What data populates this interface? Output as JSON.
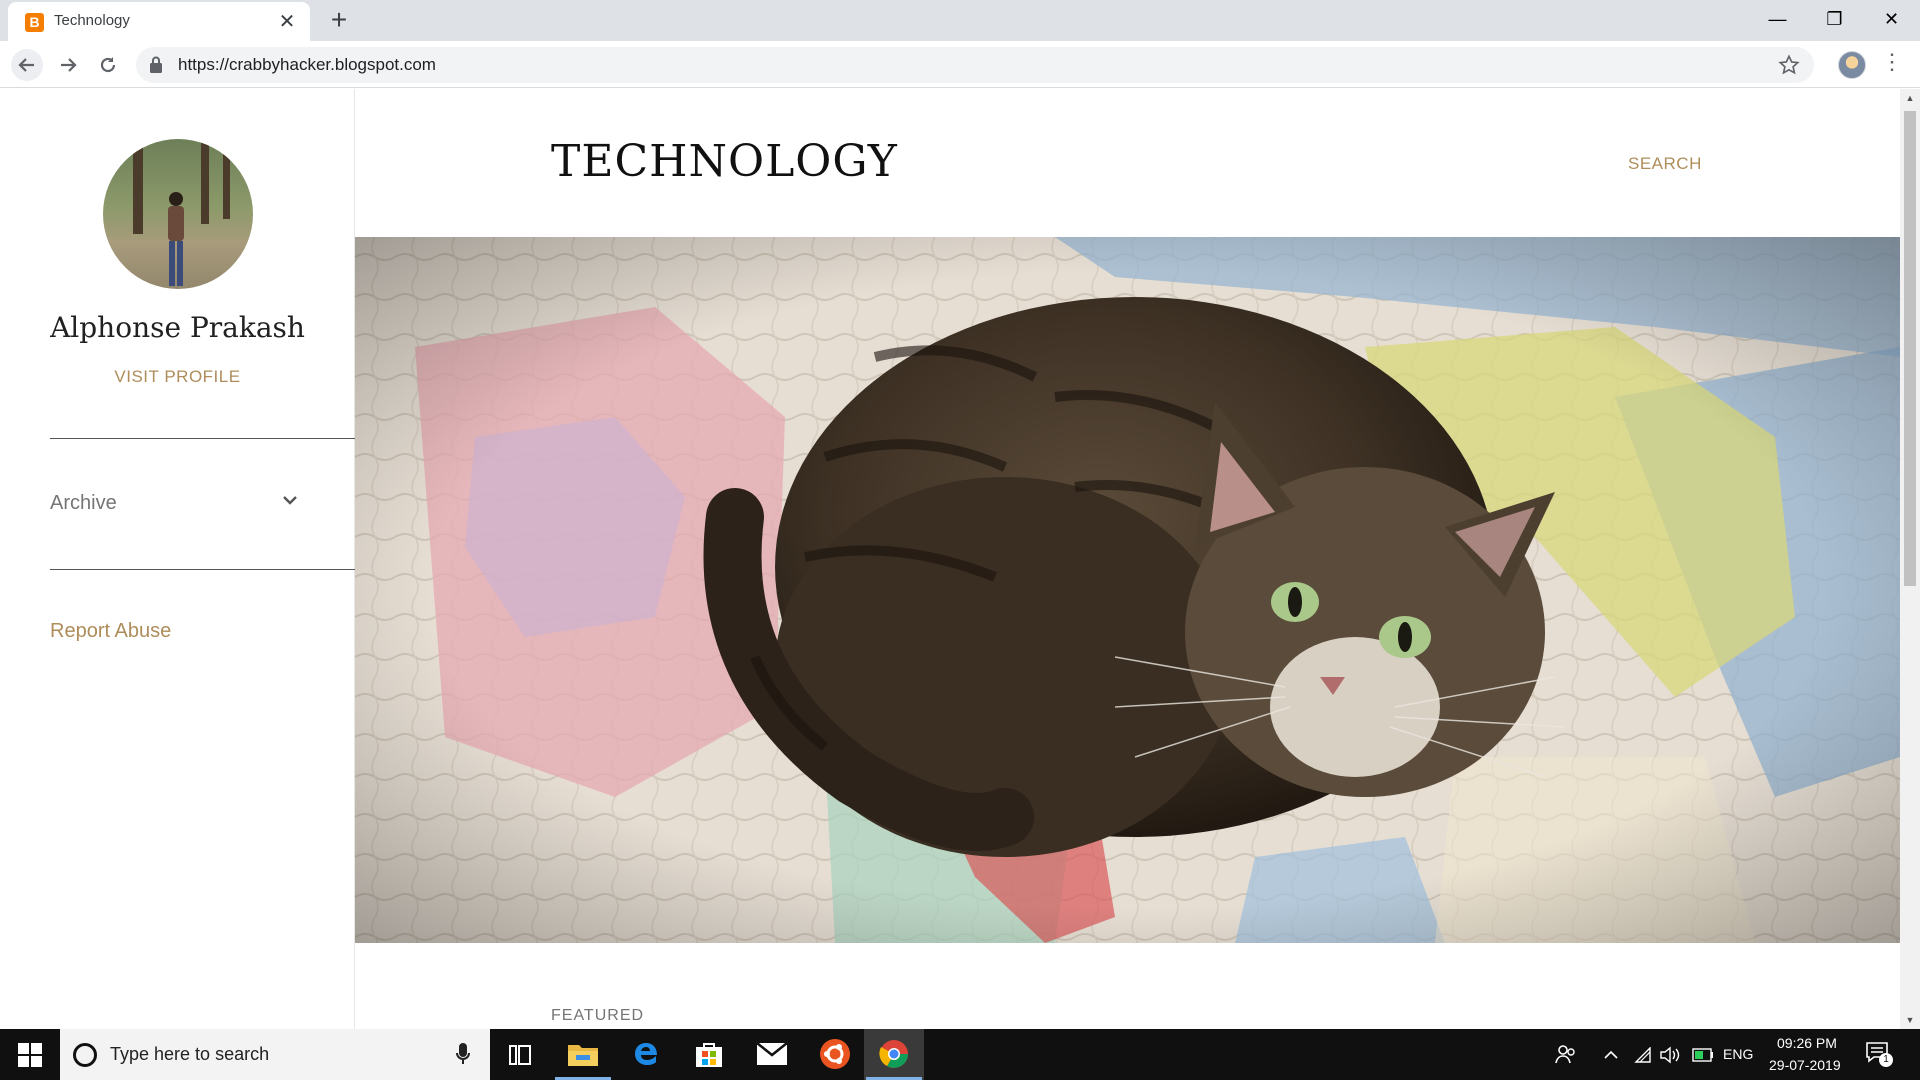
{
  "browser": {
    "tab_title": "Technology",
    "tab_favicon": "B",
    "new_tab_label": "+",
    "close_tab_label": "✕",
    "window_controls": {
      "minimize": "—",
      "maximize": "❐",
      "close": "✕"
    },
    "url": "https://crabbyhacker.blogspot.com",
    "menu_label": "⋮"
  },
  "sidebar": {
    "profile_name": "Alphonse Prakash",
    "visit_profile": "VISIT PROFILE",
    "archive_label": "Archive",
    "report_abuse": "Report Abuse"
  },
  "blog": {
    "title": "TECHNOLOGY",
    "search_label": "SEARCH",
    "featured_label": "FEATURED"
  },
  "taskbar": {
    "search_placeholder": "Type here to search",
    "language": "ENG",
    "time": "09:26 PM",
    "date": "29-07-2019",
    "notification_count": "1"
  },
  "colors": {
    "accent": "#ae8d5a",
    "tabstrip_bg": "#dee1e6",
    "taskbar_bg": "#101010"
  },
  "icons": {
    "back": "arrow-left-icon",
    "forward": "arrow-right-icon",
    "reload": "reload-icon",
    "lock": "lock-icon",
    "bookmark": "star-icon",
    "menu": "kebab-menu-icon",
    "archive_toggle": "chevron-down-icon",
    "start": "windows-logo-icon",
    "task_view": "task-view-icon",
    "file_explorer": "folder-icon",
    "edge": "edge-icon",
    "store": "store-icon",
    "mail": "mail-icon",
    "ubuntu": "ubuntu-icon",
    "chrome": "chrome-icon"
  }
}
